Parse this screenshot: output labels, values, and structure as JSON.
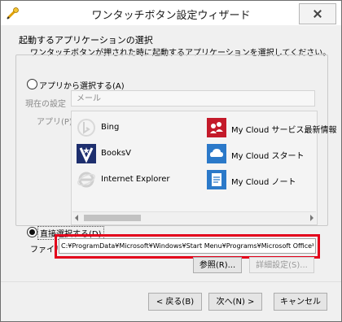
{
  "window": {
    "title": "ワンタッチボタン設定ウィザード"
  },
  "header": {
    "heading": "起動するアプリケーションの選択",
    "subheading": "ワンタッチボタンが押された時に起動するアプリケーションを選択してください。"
  },
  "app_option": {
    "label": "アプリから選択する(A)",
    "selected": false,
    "current_setting_label": "現在の設定",
    "current_setting_value": "メール",
    "apps_label": "アプリ(P):",
    "apps": [
      {
        "name": "Bing",
        "icon": "bing-icon"
      },
      {
        "name": "My Cloud サービス最新情報",
        "icon": "my-cloud-news-icon"
      },
      {
        "name": "BooksV",
        "icon": "booksv-icon"
      },
      {
        "name": "My Cloud スタート",
        "icon": "my-cloud-start-icon"
      },
      {
        "name": "Internet Explorer",
        "icon": "internet-explorer-icon"
      },
      {
        "name": "My Cloud ノート",
        "icon": "my-cloud-note-icon"
      }
    ]
  },
  "direct_option": {
    "label": "直接選択する(D)",
    "selected": true,
    "file_label": "ファイル",
    "file_value": "C:¥ProgramData¥Microsoft¥Windows¥Start Menu¥Programs¥Microsoft Office¥Mic",
    "browse_label": "参照(R)...",
    "advanced_label": "詳細設定(S)..."
  },
  "footer": {
    "back_label": "< 戻る(B)",
    "next_label": "次へ(N) >",
    "cancel_label": "キャンセル"
  },
  "colors": {
    "highlight_border": "#e3001b",
    "window_bg": "#f0f0f0",
    "my_cloud_red": "#c41a2a",
    "my_cloud_blue": "#2b79c9"
  }
}
